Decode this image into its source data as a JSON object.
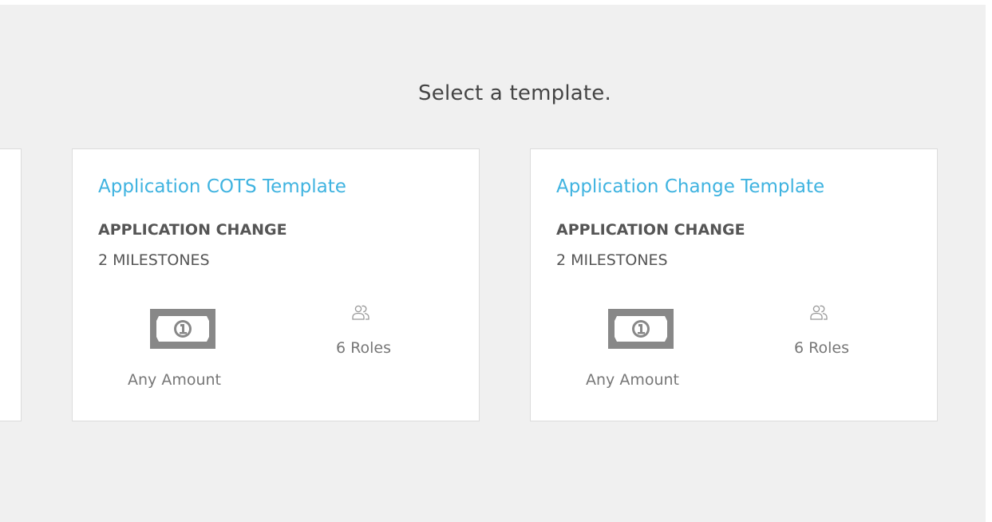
{
  "page": {
    "title": "Select a template."
  },
  "templates": [
    {
      "name": "Application COTS Template",
      "type": "APPLICATION CHANGE",
      "milestones": "2 MILESTONES",
      "amount_label": "Any Amount",
      "amount_icon": "money-bill-icon",
      "roles_label": "6 Roles",
      "roles_icon": "users-icon"
    },
    {
      "name": "Application Change Template",
      "type": "APPLICATION CHANGE",
      "milestones": "2 MILESTONES",
      "amount_label": "Any Amount",
      "amount_icon": "money-bill-icon",
      "roles_label": "6 Roles",
      "roles_icon": "users-icon"
    }
  ],
  "colors": {
    "background": "#f0f0f0",
    "card": "#ffffff",
    "card_border": "#dcdcdc",
    "link": "#3fb3e0",
    "text_dark": "#555555",
    "text_muted": "#777777",
    "icon": "#888888"
  }
}
